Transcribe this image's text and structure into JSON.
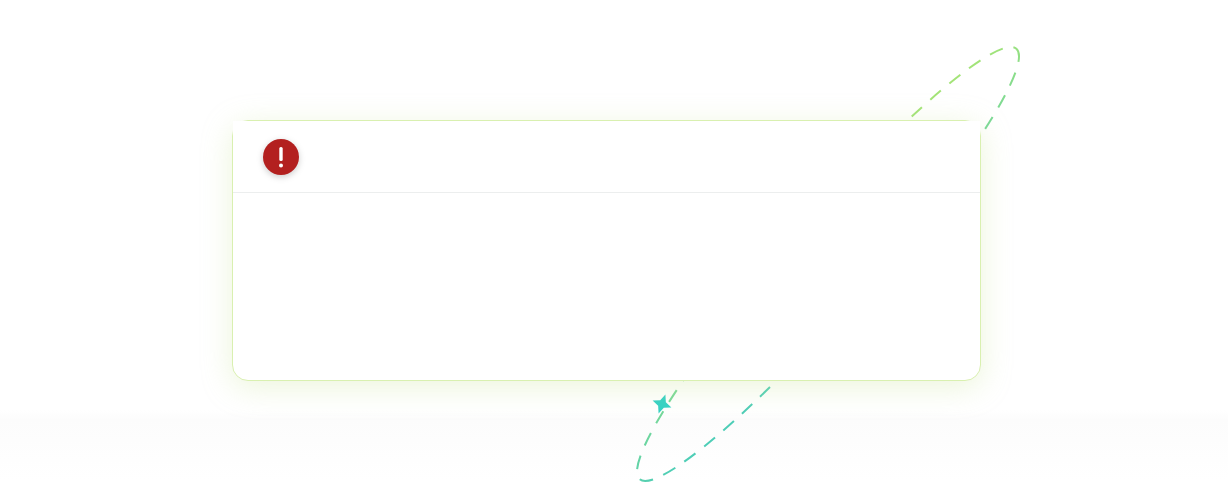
{
  "alert": {
    "kind": "error"
  }
}
